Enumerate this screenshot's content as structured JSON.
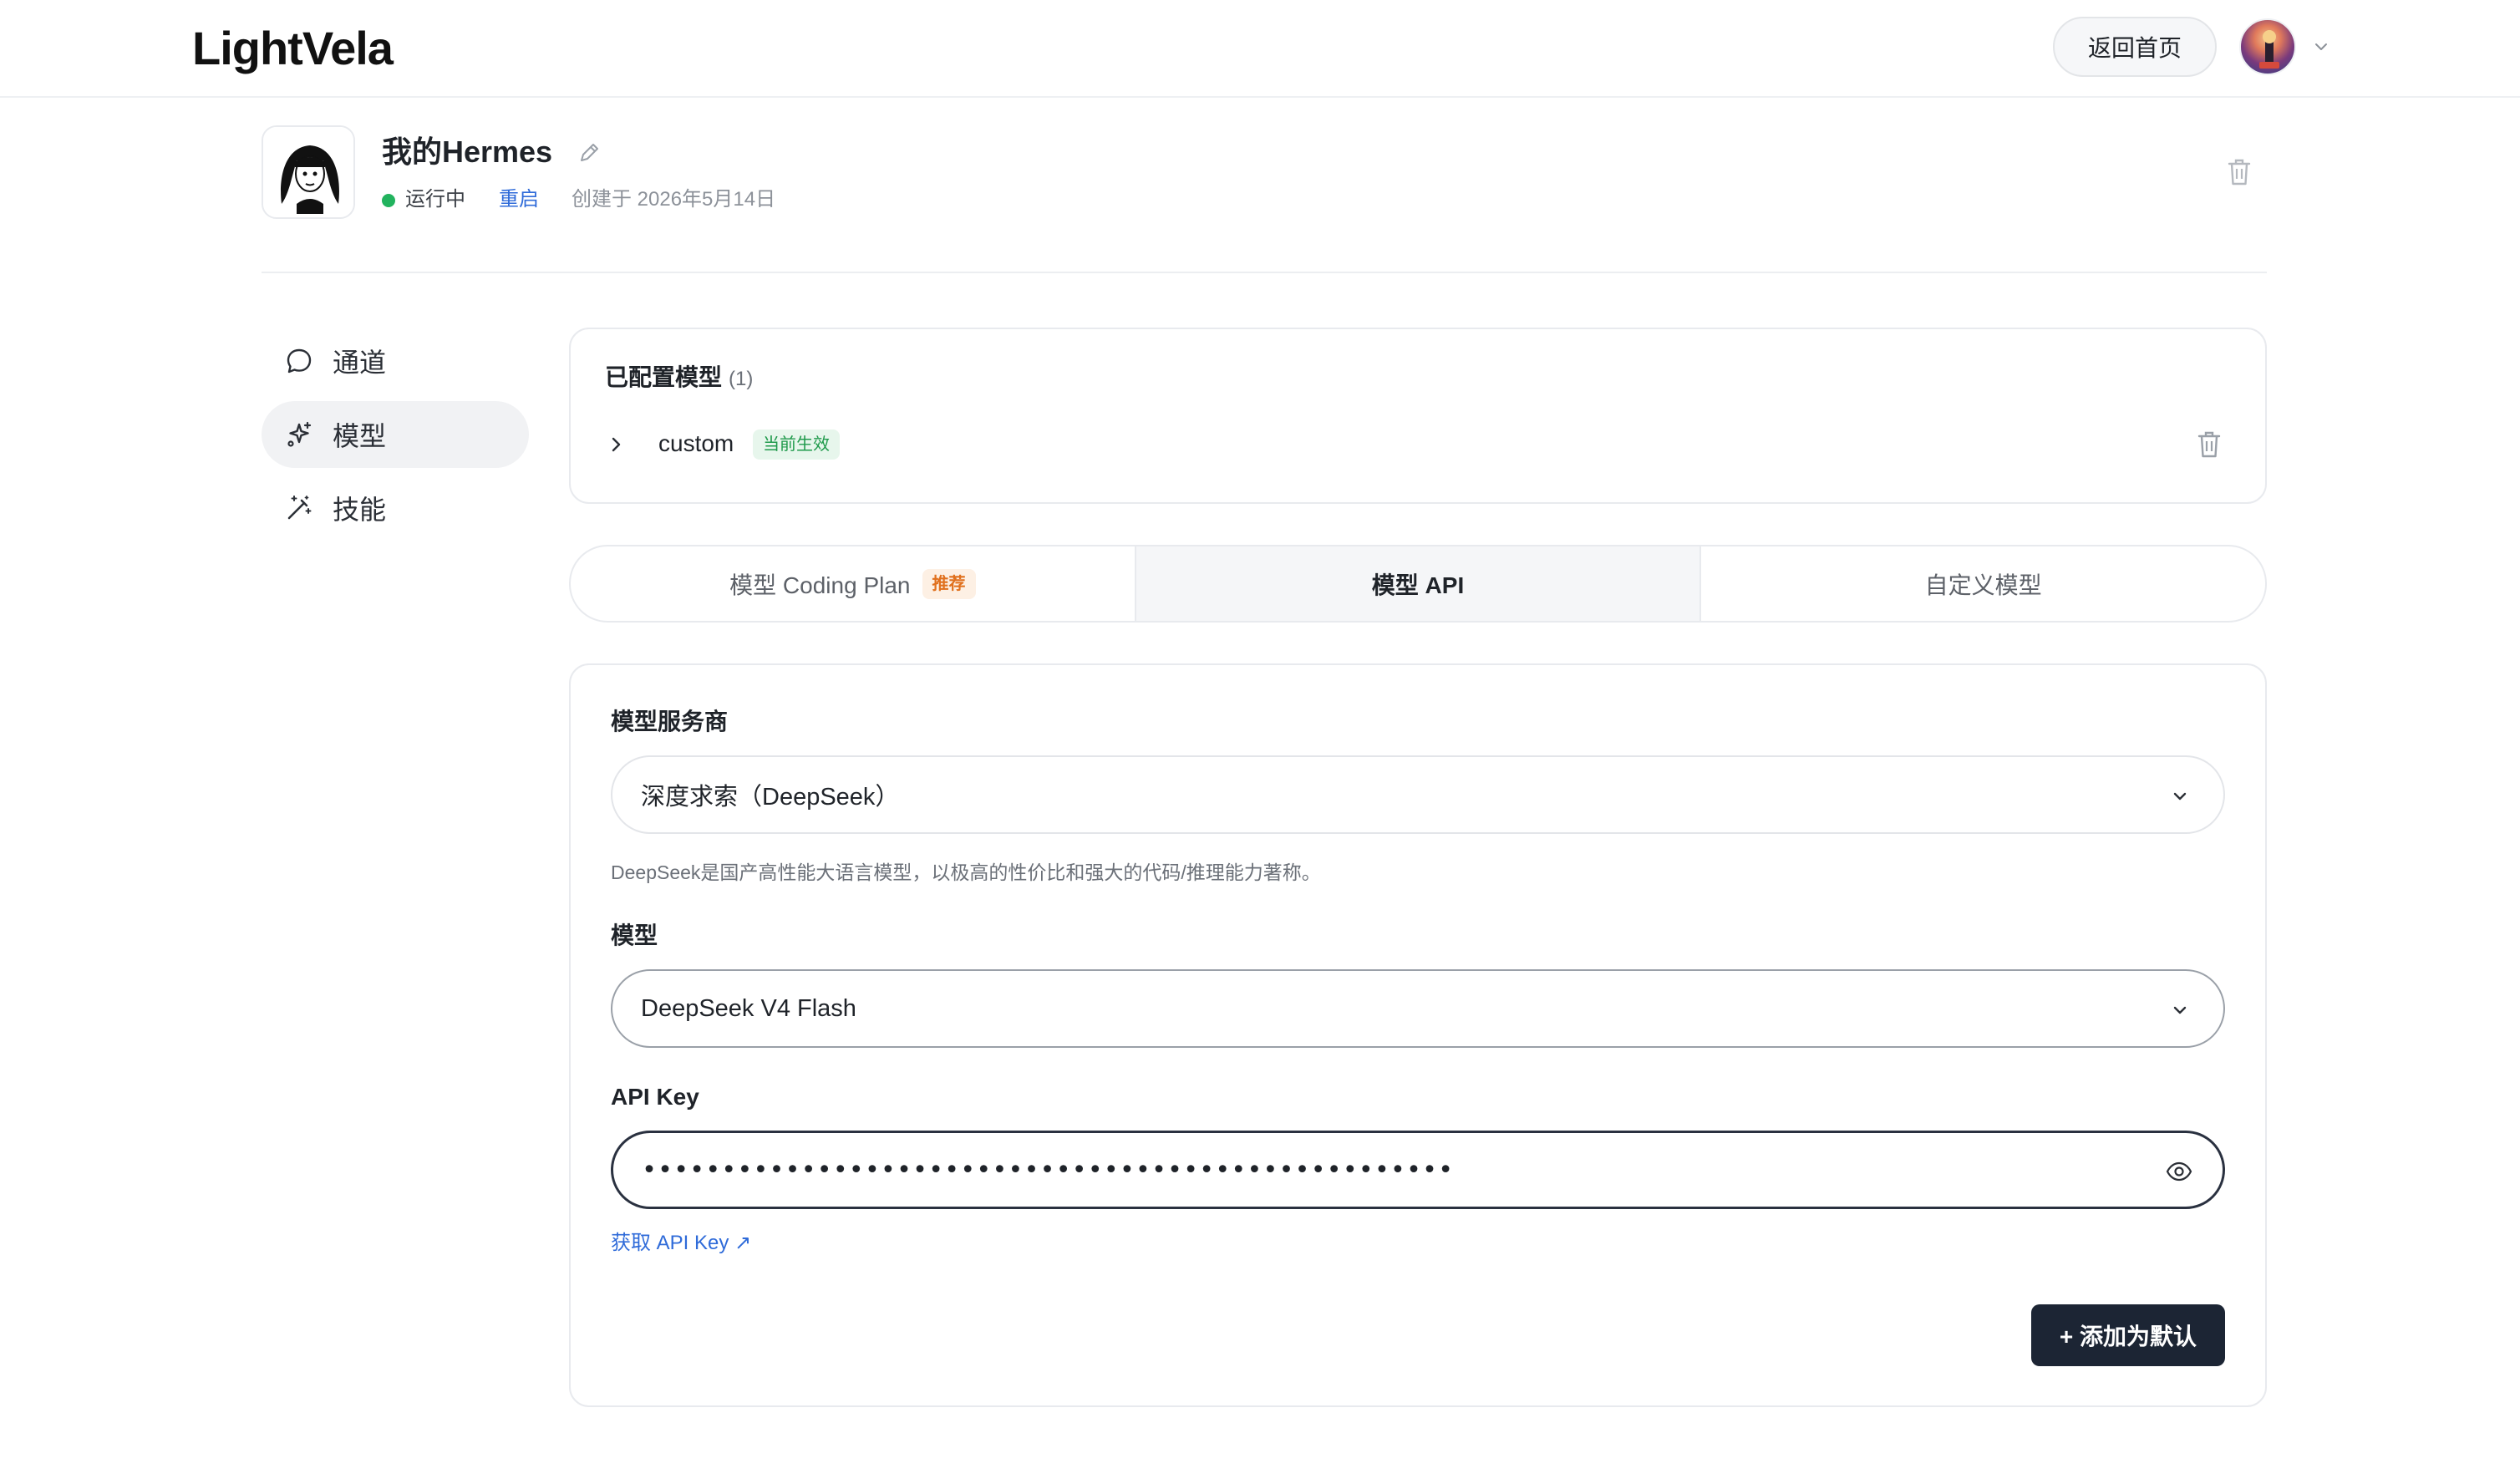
{
  "app": {
    "logo": "LightVela"
  },
  "header": {
    "home_button": "返回首页"
  },
  "instance": {
    "name": "我的Hermes",
    "status": "运行中",
    "restart": "重启",
    "created": "创建于 2026年5月14日"
  },
  "nav": {
    "items": [
      {
        "label": "通道",
        "icon": "chat-bubble-icon"
      },
      {
        "label": "模型",
        "icon": "sparkle-icon",
        "active": true
      },
      {
        "label": "技能",
        "icon": "magic-wand-icon"
      }
    ]
  },
  "configured": {
    "title": "已配置模型",
    "count": "(1)",
    "model_name": "custom",
    "badge": "当前生效"
  },
  "tabs": {
    "items": [
      {
        "label": "模型 Coding Plan",
        "badge": "推荐"
      },
      {
        "label": "模型 API",
        "active": true
      },
      {
        "label": "自定义模型"
      }
    ]
  },
  "form": {
    "provider_label": "模型服务商",
    "provider_value": "深度求索（DeepSeek）",
    "provider_desc": "DeepSeek是国产高性能大语言模型，以极高的性价比和强大的代码/推理能力著称。",
    "model_label": "模型",
    "model_value": "DeepSeek V4 Flash",
    "apikey_label": "API Key",
    "apikey_value": "•••••••••••••••••••••••••••••••••••••••••••••••••••",
    "get_key_link": "获取 API Key ↗",
    "add_button": "+ 添加为默认"
  },
  "colors": {
    "accent_link": "#2f6bd9",
    "status_green": "#22b35e",
    "primary_button": "#1c2534",
    "badge_recommend": "#e0701d"
  }
}
